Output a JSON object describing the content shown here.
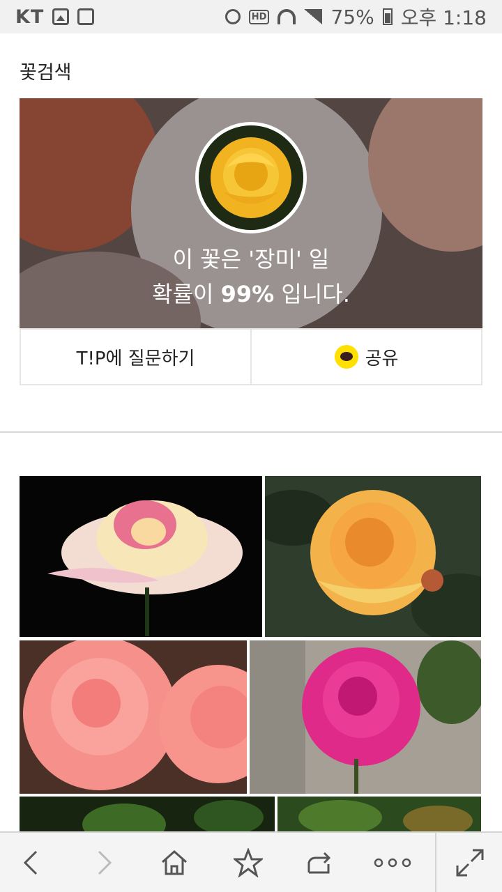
{
  "status_bar": {
    "carrier": "KT",
    "battery": "75%",
    "time": "오후 1:18",
    "hd_label": "HD",
    "icons": [
      "gallery-icon",
      "alert-icon",
      "alarm-icon",
      "hd-icon",
      "wifi-icon",
      "signal-icon",
      "battery-icon"
    ]
  },
  "header": {
    "title": "꽃검색"
  },
  "result": {
    "line1": "이 꽃은 '장미' 일",
    "line2_prefix": "확률이 ",
    "probability": "99%",
    "line2_suffix": " 입니다."
  },
  "actions": {
    "ask_label": "T!P에 질문하기",
    "share_label": "공유",
    "share_icon": "kakaotalk-icon"
  },
  "toolbar": {
    "buttons": [
      "back-icon",
      "forward-icon",
      "home-icon",
      "bookmark-star-icon",
      "share-icon",
      "more-icon",
      "fullscreen-icon"
    ]
  },
  "colors": {
    "kakao_yellow": "#ffe000",
    "status_bar_bg": "#f1f1f1",
    "toolbar_bg": "#f4f4f4"
  }
}
